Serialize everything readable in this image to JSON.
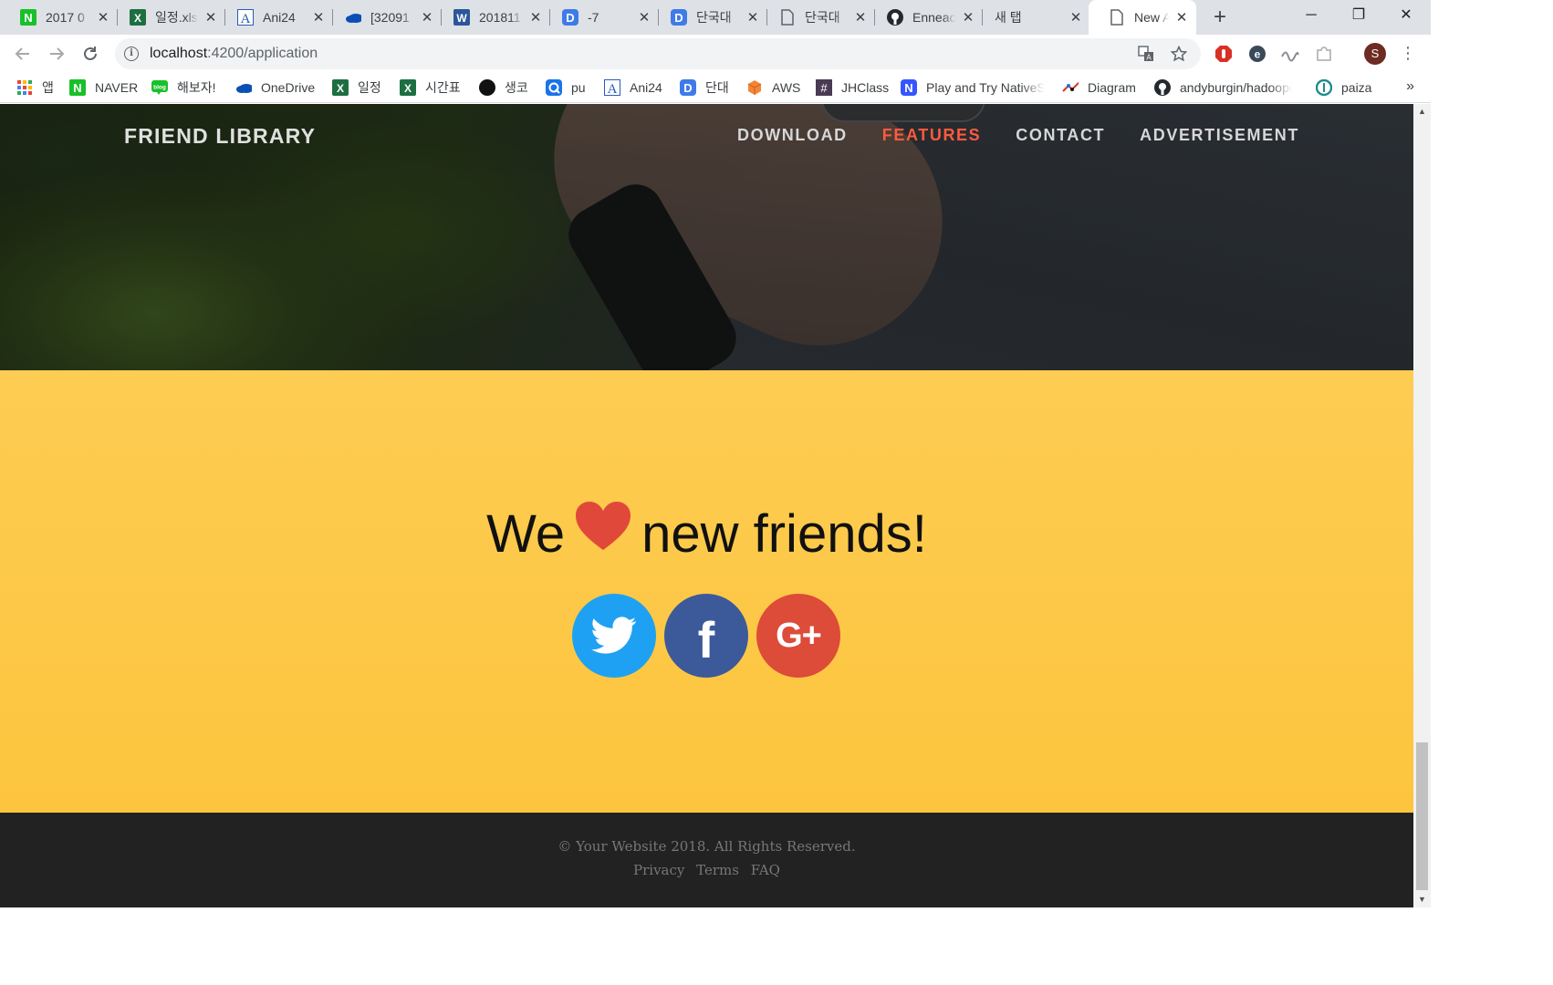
{
  "browser": {
    "tabs": [
      {
        "title": "2017 0",
        "icon": "naver-icon"
      },
      {
        "title": "일정.xls",
        "icon": "excel-icon"
      },
      {
        "title": "Ani24",
        "icon": "ani24-icon"
      },
      {
        "title": "[32091",
        "icon": "onedrive-icon"
      },
      {
        "title": "201811",
        "icon": "word-icon"
      },
      {
        "title": "-7",
        "icon": "d-icon"
      },
      {
        "title": "단국대",
        "icon": "d-icon"
      },
      {
        "title": "단국대",
        "icon": "document-icon"
      },
      {
        "title": "Enneac",
        "icon": "github-icon"
      },
      {
        "title": "새 탭",
        "icon": ""
      },
      {
        "title": "New A",
        "icon": "document-icon"
      }
    ],
    "close_glyph": "✕",
    "new_tab_glyph": "+",
    "window_controls": {
      "minimize": "─",
      "maximize": "❐",
      "close": "✕"
    },
    "url": {
      "host": "localhost",
      "path": ":4200/application"
    },
    "info_glyph": "i",
    "profile_initial": "S",
    "bookmarks": [
      {
        "label": "앱",
        "icon": "apps-grid-icon"
      },
      {
        "label": "NAVER",
        "icon": "naver-icon"
      },
      {
        "label": "해보자!",
        "icon": "blog-icon"
      },
      {
        "label": "OneDrive",
        "icon": "onedrive-icon"
      },
      {
        "label": "일정",
        "icon": "excel-icon"
      },
      {
        "label": "시간표",
        "icon": "excel-icon"
      },
      {
        "label": "생코",
        "icon": "black-circle-icon"
      },
      {
        "label": "pu",
        "icon": "q-icon"
      },
      {
        "label": "Ani24",
        "icon": "ani24-icon"
      },
      {
        "label": "단대",
        "icon": "d-icon"
      },
      {
        "label": "AWS",
        "icon": "aws-icon"
      },
      {
        "label": "JHClass",
        "icon": "hash-icon"
      },
      {
        "label": "Play and Try NativeS",
        "icon": "n-icon"
      },
      {
        "label": "Diagram",
        "icon": "diagram-icon"
      },
      {
        "label": "andyburgin/hadoopi",
        "icon": "github-icon"
      },
      {
        "label": "paiza",
        "icon": "paiza-icon"
      }
    ],
    "more_glyph": "»"
  },
  "page": {
    "brand": "FRIEND LIBRARY",
    "nav": [
      "DOWNLOAD",
      "FEATURES",
      "CONTACT",
      "ADVERTISEMENT"
    ],
    "active_nav": "FEATURES",
    "headline_before": "We",
    "headline_after": "new friends!",
    "social": [
      {
        "name": "twitter",
        "color": "#1ea1f2"
      },
      {
        "name": "facebook",
        "color": "#3c5a99",
        "glyph": "f"
      },
      {
        "name": "google-plus",
        "color": "#dd4b39",
        "glyph": "G+"
      }
    ],
    "footer": {
      "copyright": "© Your Website 2018. All Rights Reserved.",
      "links": [
        "Privacy",
        "Terms",
        "FAQ"
      ]
    }
  },
  "colors": {
    "accent": "#fd5b3f",
    "yellow": "#fdcc52",
    "heart": "#e0493a",
    "footer": "#222222"
  }
}
